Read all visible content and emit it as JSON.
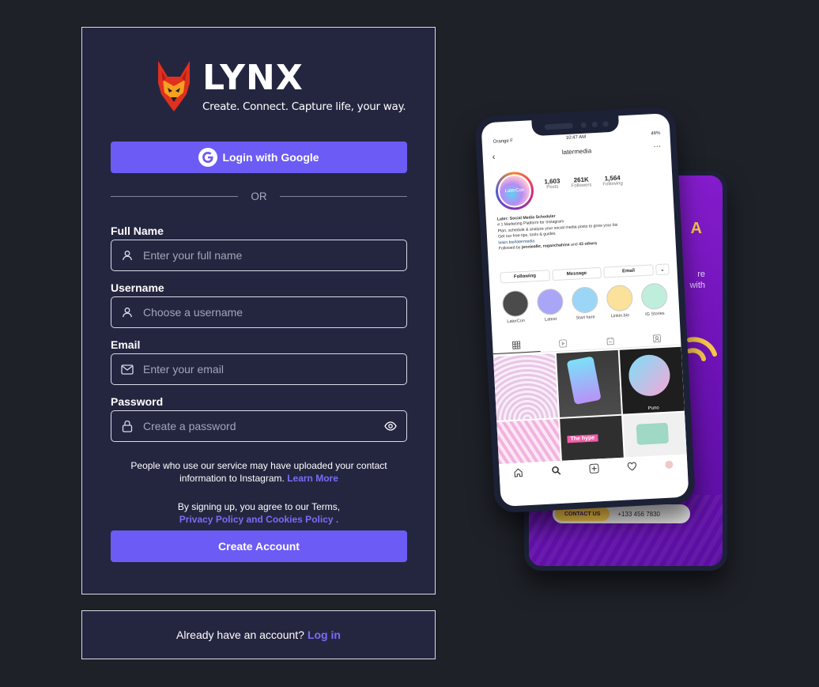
{
  "brand": {
    "name": "LYNX",
    "tagline": "Create. Connect. Capture life, your way."
  },
  "signup": {
    "google_button": "Login with Google",
    "divider": "OR",
    "fields": {
      "full_name": {
        "label": "Full Name",
        "placeholder": "Enter your full name",
        "icon": "user-icon"
      },
      "username": {
        "label": "Username",
        "placeholder": "Choose a username",
        "icon": "user-icon"
      },
      "email": {
        "label": "Email",
        "placeholder": "Enter your email",
        "icon": "mail-icon"
      },
      "password": {
        "label": "Password",
        "placeholder": "Create a password",
        "icon": "lock-icon",
        "toggle_icon": "eye-icon"
      }
    },
    "upload_notice": {
      "text": "People who use our service may have uploaded your contact information to Instagram.",
      "link": "Learn More"
    },
    "terms_notice": {
      "text": "By signing up, you agree to our Terms,",
      "link": "Privacy Policy and Cookies Policy ."
    },
    "create_button": "Create Account"
  },
  "login": {
    "prompt": "Already have an account?",
    "link": "Log in"
  },
  "mockup": {
    "status_bar": {
      "carrier": "Orange F",
      "time": "10:47 AM",
      "battery": "46%"
    },
    "profile": {
      "username": "latermedia",
      "avatar_text": "LaterCon",
      "stats": [
        {
          "value": "1,603",
          "label": "Posts"
        },
        {
          "value": "261K",
          "label": "Followers"
        },
        {
          "value": "1,564",
          "label": "Following"
        }
      ],
      "bio": {
        "name": "Later: Social Media Scheduler",
        "line1": "# 1 Marketing Platform for Instagram",
        "line2": "Plan, schedule & analyze your social media posts to grow your biz",
        "line3": "Get our free tips, tools & guides",
        "link": "linkin.bio/latermedia",
        "followed_prefix": "Followed by",
        "followed_names": "jenniealkr, roganchahine",
        "followed_suffix": "and",
        "followed_others": "43 others"
      },
      "buttons": {
        "following": "Following",
        "message": "Message",
        "email": "Email"
      },
      "highlights": [
        "LaterCon",
        "Latest",
        "Start here",
        "Linkin.bio",
        "IG Stories"
      ],
      "post_captions": {
        "post3": "Puno",
        "post5": "The hype"
      }
    },
    "back_phone": {
      "letter": "A",
      "text_line1": "re",
      "text_line2": "with",
      "contact_button": "CONTACT US",
      "phone_number": "+133 456 7830"
    }
  },
  "colors": {
    "background": "#1e2128",
    "card": "#242640",
    "accent": "#6c5bf5",
    "link": "#7b6cf7",
    "border": "#d8dbe6"
  }
}
